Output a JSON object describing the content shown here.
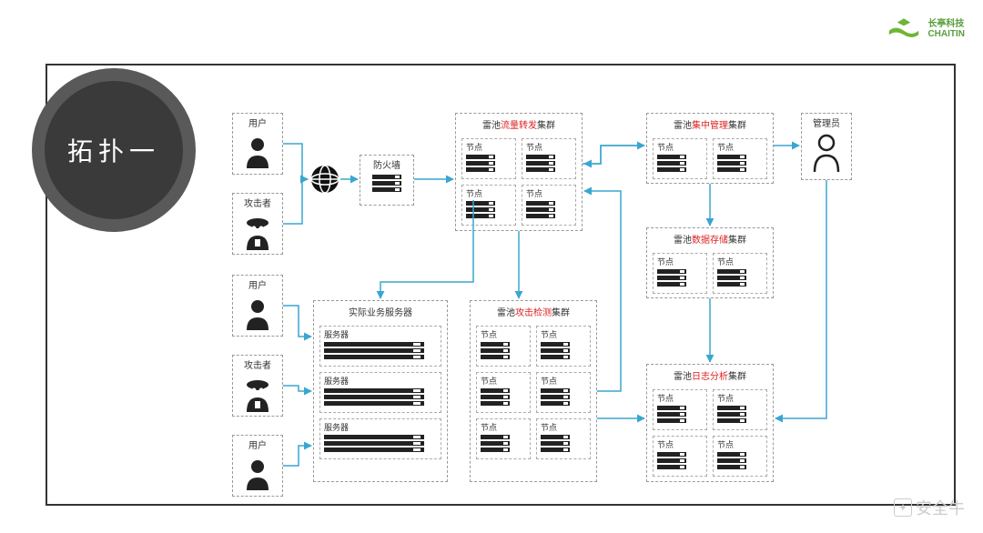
{
  "title": "拓扑一",
  "brand": {
    "name_cn": "长亭科技",
    "name_en": "CHAITIN"
  },
  "actors": {
    "user1": "用户",
    "attacker1": "攻击者",
    "user2": "用户",
    "attacker2": "攻击者",
    "user3": "用户",
    "admin": "管理员"
  },
  "firewall": "防火墙",
  "clusters": {
    "traffic": {
      "prefix": "雷池",
      "red": "流量转发",
      "suffix": "集群"
    },
    "mgmt": {
      "prefix": "雷池",
      "red": "集中管理",
      "suffix": "集群"
    },
    "storage": {
      "prefix": "雷池",
      "red": "数据存储",
      "suffix": "集群"
    },
    "detect": {
      "prefix": "雷池",
      "red": "攻击检测",
      "suffix": "集群"
    },
    "log": {
      "prefix": "雷池",
      "red": "日志分析",
      "suffix": "集群"
    },
    "biz": "实际业务服务器"
  },
  "node_label": "节点",
  "server_label": "服务器",
  "watermark": "安全牛"
}
